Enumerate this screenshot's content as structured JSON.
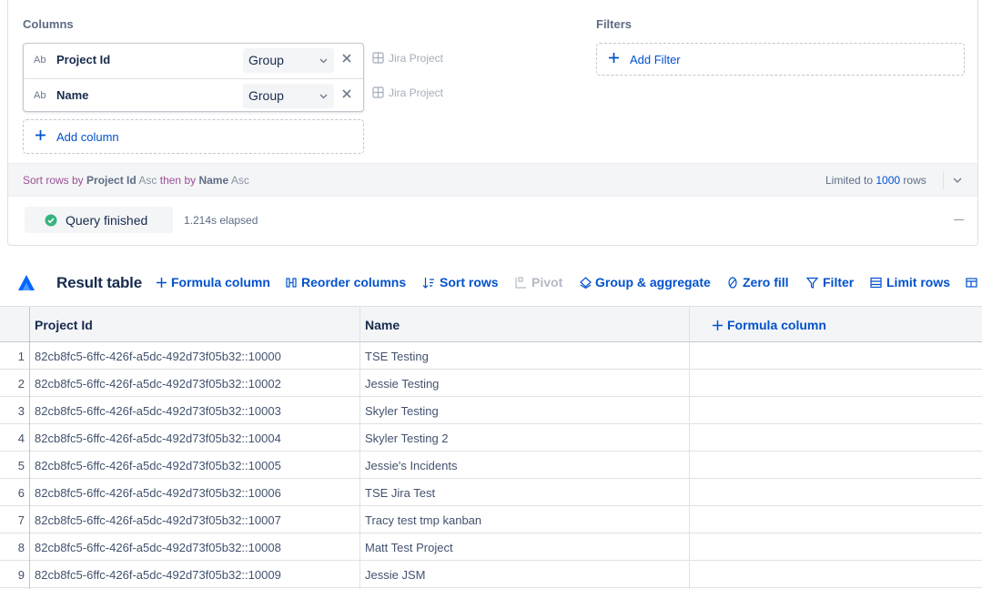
{
  "builder": {
    "columns_label": "Columns",
    "filters_label": "Filters",
    "columns": [
      {
        "type_badge": "Ab",
        "name": "Project Id",
        "aggregation": "Group",
        "source": "Jira Project"
      },
      {
        "type_badge": "Ab",
        "name": "Name",
        "aggregation": "Group",
        "source": "Jira Project"
      }
    ],
    "add_column_label": "Add column",
    "add_filter_label": "Add Filter",
    "sort": {
      "prefix": "Sort rows by",
      "first_field": "Project Id",
      "first_dir": "Asc",
      "joiner": "then by",
      "second_field": "Name",
      "second_dir": "Asc"
    },
    "limit": {
      "prefix": "Limited to",
      "value": "1000",
      "suffix": "rows"
    },
    "status": {
      "label": "Query finished",
      "elapsed": "1.214s elapsed"
    }
  },
  "toolbar": {
    "title": "Result table",
    "formula_column": "Formula column",
    "reorder_columns": "Reorder columns",
    "sort_rows": "Sort rows",
    "pivot": "Pivot",
    "group_aggregate": "Group & aggregate",
    "zero_fill": "Zero fill",
    "filter": "Filter",
    "limit_rows": "Limit rows"
  },
  "table": {
    "headers": [
      "Project Id",
      "Name"
    ],
    "formula_header": "Formula column",
    "rows": [
      {
        "n": "1",
        "project_id": "82cb8fc5-6ffc-426f-a5dc-492d73f05b32::10000",
        "name": "TSE Testing"
      },
      {
        "n": "2",
        "project_id": "82cb8fc5-6ffc-426f-a5dc-492d73f05b32::10002",
        "name": "Jessie Testing"
      },
      {
        "n": "3",
        "project_id": "82cb8fc5-6ffc-426f-a5dc-492d73f05b32::10003",
        "name": "Skyler Testing"
      },
      {
        "n": "4",
        "project_id": "82cb8fc5-6ffc-426f-a5dc-492d73f05b32::10004",
        "name": "Skyler Testing 2"
      },
      {
        "n": "5",
        "project_id": "82cb8fc5-6ffc-426f-a5dc-492d73f05b32::10005",
        "name": "Jessie's Incidents"
      },
      {
        "n": "6",
        "project_id": "82cb8fc5-6ffc-426f-a5dc-492d73f05b32::10006",
        "name": "TSE Jira Test"
      },
      {
        "n": "7",
        "project_id": "82cb8fc5-6ffc-426f-a5dc-492d73f05b32::10007",
        "name": "Tracy test tmp kanban"
      },
      {
        "n": "8",
        "project_id": "82cb8fc5-6ffc-426f-a5dc-492d73f05b32::10008",
        "name": "Matt Test Project"
      },
      {
        "n": "9",
        "project_id": "82cb8fc5-6ffc-426f-a5dc-492d73f05b32::10009",
        "name": "Jessie JSM"
      }
    ]
  },
  "colors": {
    "accent": "#0052cc",
    "success": "#36b37e",
    "text": "#172b4d",
    "muted": "#5e6c84"
  },
  "icons": [
    "plus-icon",
    "close-icon",
    "chevron-down-icon",
    "table-icon",
    "check-circle-icon",
    "logo-icon",
    "reorder-icon",
    "sort-icon",
    "pivot-icon",
    "group-icon",
    "zero-fill-icon",
    "filter-icon",
    "limit-icon"
  ]
}
